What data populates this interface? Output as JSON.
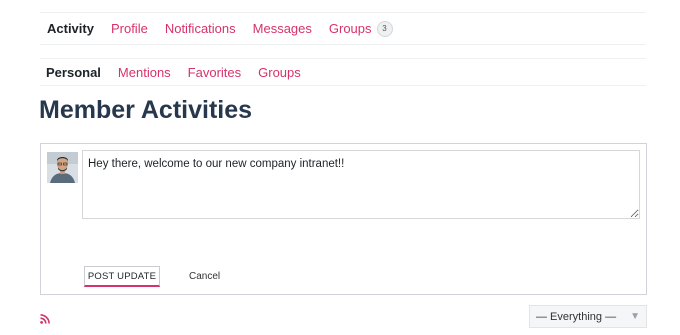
{
  "primary_nav": {
    "items": [
      {
        "label": "Activity",
        "active": true
      },
      {
        "label": "Profile"
      },
      {
        "label": "Notifications"
      },
      {
        "label": "Messages"
      },
      {
        "label": "Groups",
        "badge": "3"
      }
    ]
  },
  "secondary_nav": {
    "items": [
      {
        "label": "Personal",
        "active": true
      },
      {
        "label": "Mentions"
      },
      {
        "label": "Favorites"
      },
      {
        "label": "Groups"
      }
    ]
  },
  "page": {
    "title": "Member Activities"
  },
  "post_form": {
    "text": "Hey there, welcome to our new company intranet!!",
    "post_label": "POST UPDATE",
    "cancel_label": "Cancel"
  },
  "filter": {
    "selected": "— Everything —"
  },
  "icons": {
    "rss": "rss-feed-icon",
    "dropdown": "triangle-down-icon",
    "avatar": "user-avatar"
  },
  "colors": {
    "accent": "#d6336c",
    "title": "#27384c",
    "text": "#1d2327"
  }
}
